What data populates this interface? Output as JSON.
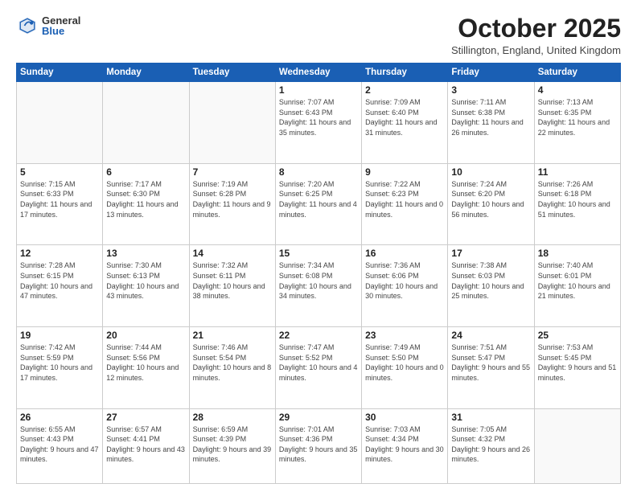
{
  "header": {
    "logo_general": "General",
    "logo_blue": "Blue",
    "month_title": "October 2025",
    "location": "Stillington, England, United Kingdom"
  },
  "days_of_week": [
    "Sunday",
    "Monday",
    "Tuesday",
    "Wednesday",
    "Thursday",
    "Friday",
    "Saturday"
  ],
  "weeks": [
    [
      {
        "day": "",
        "info": ""
      },
      {
        "day": "",
        "info": ""
      },
      {
        "day": "",
        "info": ""
      },
      {
        "day": "1",
        "info": "Sunrise: 7:07 AM\nSunset: 6:43 PM\nDaylight: 11 hours\nand 35 minutes."
      },
      {
        "day": "2",
        "info": "Sunrise: 7:09 AM\nSunset: 6:40 PM\nDaylight: 11 hours\nand 31 minutes."
      },
      {
        "day": "3",
        "info": "Sunrise: 7:11 AM\nSunset: 6:38 PM\nDaylight: 11 hours\nand 26 minutes."
      },
      {
        "day": "4",
        "info": "Sunrise: 7:13 AM\nSunset: 6:35 PM\nDaylight: 11 hours\nand 22 minutes."
      }
    ],
    [
      {
        "day": "5",
        "info": "Sunrise: 7:15 AM\nSunset: 6:33 PM\nDaylight: 11 hours\nand 17 minutes."
      },
      {
        "day": "6",
        "info": "Sunrise: 7:17 AM\nSunset: 6:30 PM\nDaylight: 11 hours\nand 13 minutes."
      },
      {
        "day": "7",
        "info": "Sunrise: 7:19 AM\nSunset: 6:28 PM\nDaylight: 11 hours\nand 9 minutes."
      },
      {
        "day": "8",
        "info": "Sunrise: 7:20 AM\nSunset: 6:25 PM\nDaylight: 11 hours\nand 4 minutes."
      },
      {
        "day": "9",
        "info": "Sunrise: 7:22 AM\nSunset: 6:23 PM\nDaylight: 11 hours\nand 0 minutes."
      },
      {
        "day": "10",
        "info": "Sunrise: 7:24 AM\nSunset: 6:20 PM\nDaylight: 10 hours\nand 56 minutes."
      },
      {
        "day": "11",
        "info": "Sunrise: 7:26 AM\nSunset: 6:18 PM\nDaylight: 10 hours\nand 51 minutes."
      }
    ],
    [
      {
        "day": "12",
        "info": "Sunrise: 7:28 AM\nSunset: 6:15 PM\nDaylight: 10 hours\nand 47 minutes."
      },
      {
        "day": "13",
        "info": "Sunrise: 7:30 AM\nSunset: 6:13 PM\nDaylight: 10 hours\nand 43 minutes."
      },
      {
        "day": "14",
        "info": "Sunrise: 7:32 AM\nSunset: 6:11 PM\nDaylight: 10 hours\nand 38 minutes."
      },
      {
        "day": "15",
        "info": "Sunrise: 7:34 AM\nSunset: 6:08 PM\nDaylight: 10 hours\nand 34 minutes."
      },
      {
        "day": "16",
        "info": "Sunrise: 7:36 AM\nSunset: 6:06 PM\nDaylight: 10 hours\nand 30 minutes."
      },
      {
        "day": "17",
        "info": "Sunrise: 7:38 AM\nSunset: 6:03 PM\nDaylight: 10 hours\nand 25 minutes."
      },
      {
        "day": "18",
        "info": "Sunrise: 7:40 AM\nSunset: 6:01 PM\nDaylight: 10 hours\nand 21 minutes."
      }
    ],
    [
      {
        "day": "19",
        "info": "Sunrise: 7:42 AM\nSunset: 5:59 PM\nDaylight: 10 hours\nand 17 minutes."
      },
      {
        "day": "20",
        "info": "Sunrise: 7:44 AM\nSunset: 5:56 PM\nDaylight: 10 hours\nand 12 minutes."
      },
      {
        "day": "21",
        "info": "Sunrise: 7:46 AM\nSunset: 5:54 PM\nDaylight: 10 hours\nand 8 minutes."
      },
      {
        "day": "22",
        "info": "Sunrise: 7:47 AM\nSunset: 5:52 PM\nDaylight: 10 hours\nand 4 minutes."
      },
      {
        "day": "23",
        "info": "Sunrise: 7:49 AM\nSunset: 5:50 PM\nDaylight: 10 hours\nand 0 minutes."
      },
      {
        "day": "24",
        "info": "Sunrise: 7:51 AM\nSunset: 5:47 PM\nDaylight: 9 hours\nand 55 minutes."
      },
      {
        "day": "25",
        "info": "Sunrise: 7:53 AM\nSunset: 5:45 PM\nDaylight: 9 hours\nand 51 minutes."
      }
    ],
    [
      {
        "day": "26",
        "info": "Sunrise: 6:55 AM\nSunset: 4:43 PM\nDaylight: 9 hours\nand 47 minutes."
      },
      {
        "day": "27",
        "info": "Sunrise: 6:57 AM\nSunset: 4:41 PM\nDaylight: 9 hours\nand 43 minutes."
      },
      {
        "day": "28",
        "info": "Sunrise: 6:59 AM\nSunset: 4:39 PM\nDaylight: 9 hours\nand 39 minutes."
      },
      {
        "day": "29",
        "info": "Sunrise: 7:01 AM\nSunset: 4:36 PM\nDaylight: 9 hours\nand 35 minutes."
      },
      {
        "day": "30",
        "info": "Sunrise: 7:03 AM\nSunset: 4:34 PM\nDaylight: 9 hours\nand 30 minutes."
      },
      {
        "day": "31",
        "info": "Sunrise: 7:05 AM\nSunset: 4:32 PM\nDaylight: 9 hours\nand 26 minutes."
      },
      {
        "day": "",
        "info": ""
      }
    ]
  ]
}
